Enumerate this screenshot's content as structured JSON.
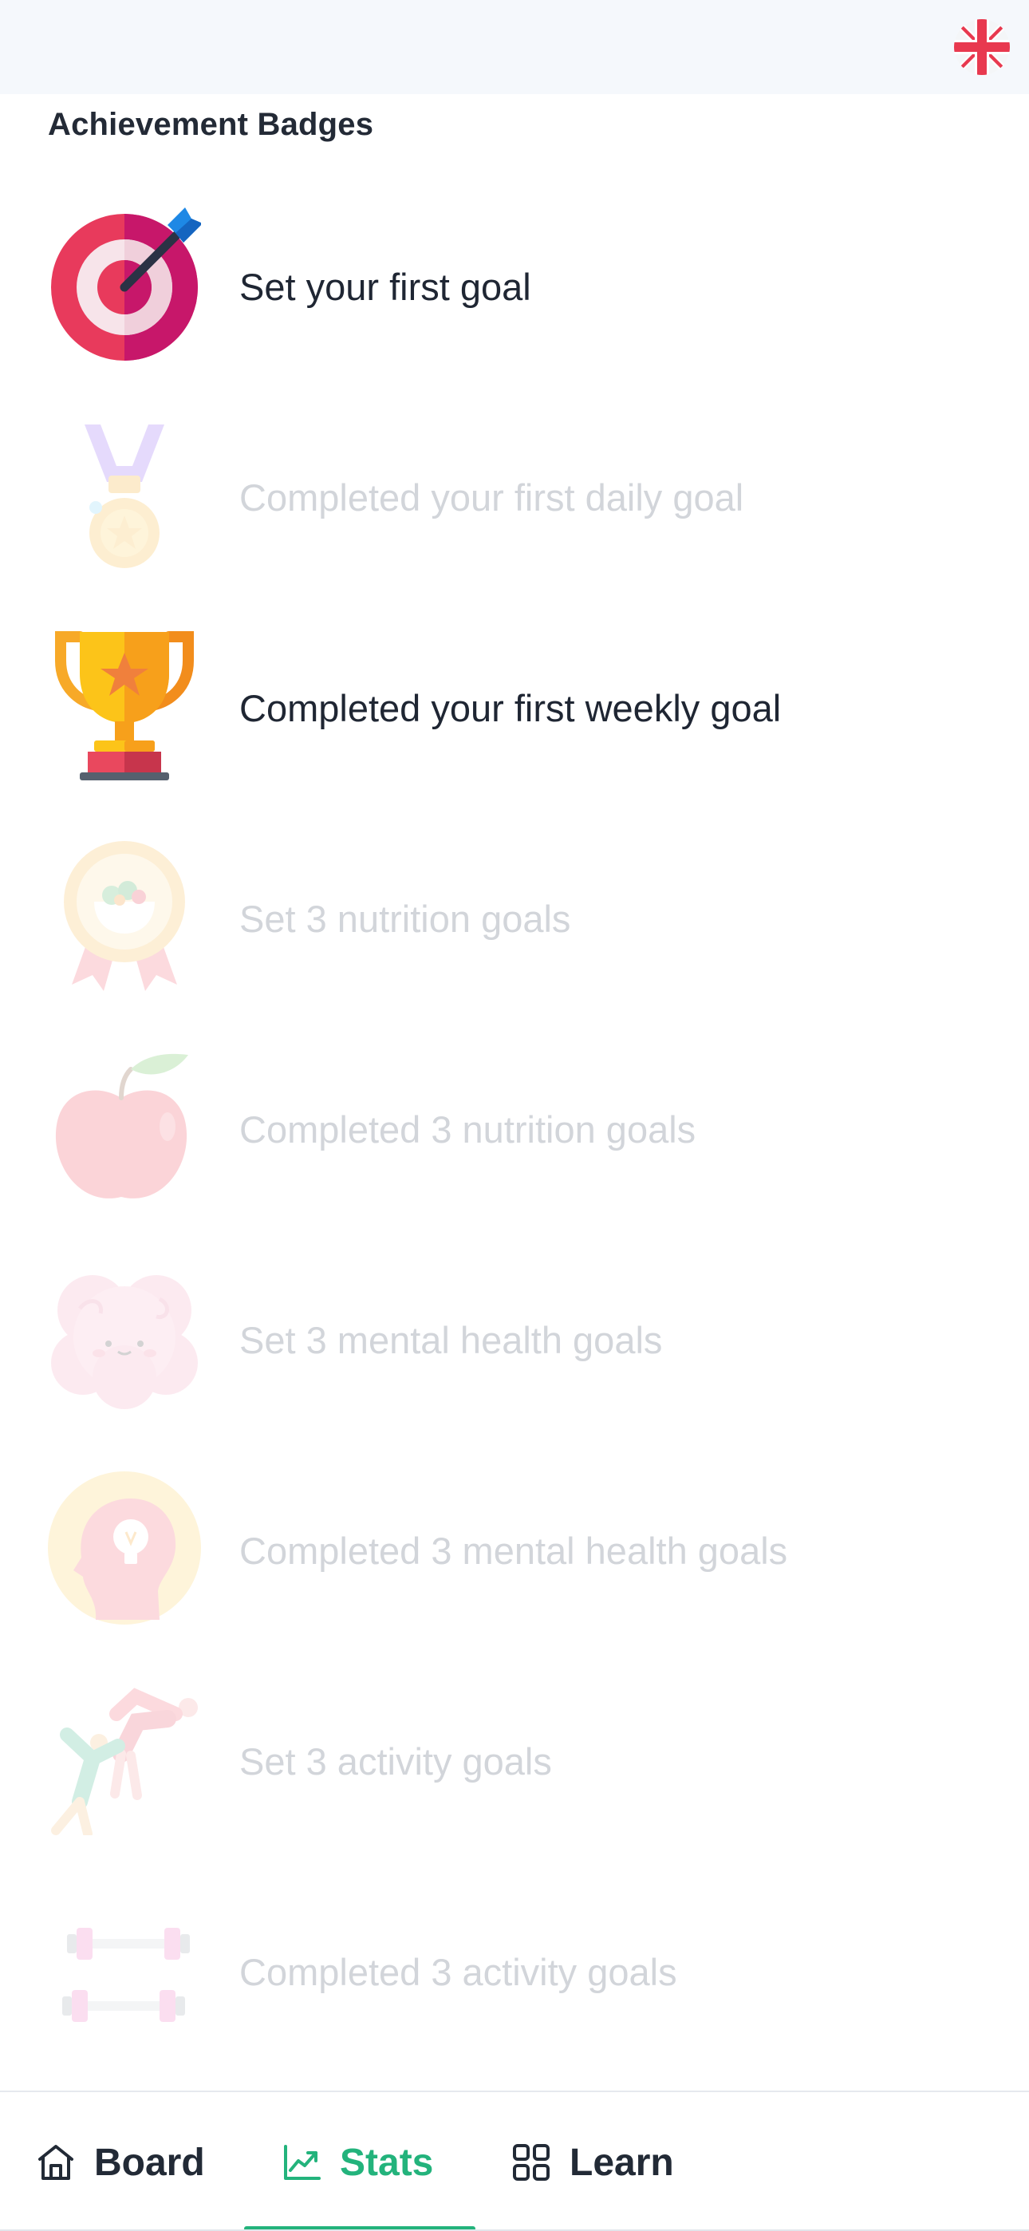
{
  "header": {
    "language_icon": "uk-flag-icon",
    "language": "English"
  },
  "section": {
    "title": "Achievement Badges"
  },
  "badges": [
    {
      "label": "Set your first goal",
      "icon": "target-dart-icon",
      "unlocked": true
    },
    {
      "label": "Completed your first daily goal",
      "icon": "medal-icon",
      "unlocked": false
    },
    {
      "label": "Completed your first weekly goal",
      "icon": "trophy-icon",
      "unlocked": true
    },
    {
      "label": "Set 3 nutrition goals",
      "icon": "salad-rosette-icon",
      "unlocked": false
    },
    {
      "label": "Completed 3 nutrition goals",
      "icon": "apple-icon",
      "unlocked": false
    },
    {
      "label": "Set 3 mental health goals",
      "icon": "brain-icon",
      "unlocked": false
    },
    {
      "label": "Completed 3 mental health goals",
      "icon": "head-lightbulb-icon",
      "unlocked": false
    },
    {
      "label": "Set 3 activity goals",
      "icon": "stretching-people-icon",
      "unlocked": false
    },
    {
      "label": "Completed 3 activity goals",
      "icon": "dumbbells-icon",
      "unlocked": false
    }
  ],
  "nav": {
    "active": "Stats",
    "tabs": [
      {
        "label": "Board",
        "icon": "home-icon"
      },
      {
        "label": "Stats",
        "icon": "chart-trend-icon"
      },
      {
        "label": "Learn",
        "icon": "grid-icon"
      }
    ]
  },
  "colors": {
    "accent": "#23b37c",
    "text": "#1f2633",
    "locked_text": "#d2d5da",
    "topbar_bg": "#f5f8fc"
  }
}
